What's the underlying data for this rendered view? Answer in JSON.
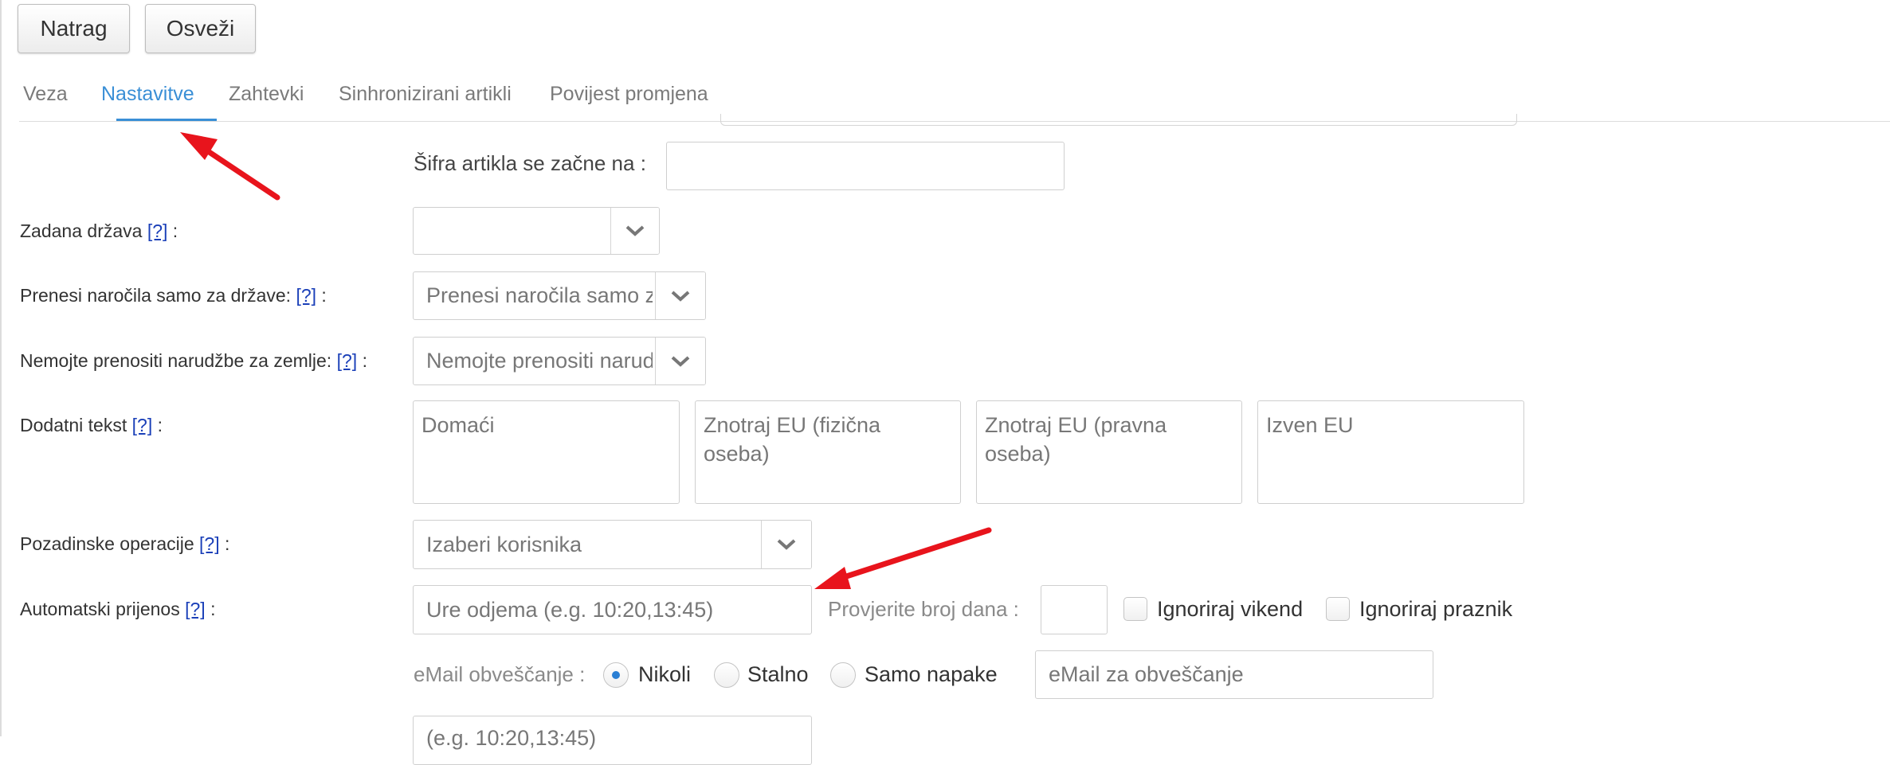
{
  "toolbar": {
    "back_label": "Natrag",
    "refresh_label": "Osveži"
  },
  "tabs": [
    {
      "label": "Veza"
    },
    {
      "label": "Nastavitve",
      "active": true
    },
    {
      "label": "Zahtevki"
    },
    {
      "label": "Sinhronizirani artikli"
    },
    {
      "label": "Povijest promjena"
    }
  ],
  "help_marker": "[?]",
  "form": {
    "sku_prefix": {
      "label": "Šifra artikla se začne na :",
      "value": ""
    },
    "default_country": {
      "label": "Zadana država",
      "suffix": ":",
      "value": ""
    },
    "transfer_only_countries": {
      "label": "Prenesi naročila samo za države:",
      "suffix": ":",
      "placeholder": "Prenesi naročila samo za države"
    },
    "exclude_countries": {
      "label": "Nemojte prenositi narudžbe za zemlje:",
      "suffix": ":",
      "placeholder": "Nemojte prenositi narudžbe za zemlje"
    },
    "additional_text": {
      "label": "Dodatni tekst",
      "suffix": ":",
      "boxes": [
        {
          "placeholder": "Domaći"
        },
        {
          "placeholder": "Znotraj EU (fizična oseba)"
        },
        {
          "placeholder": "Znotraj EU (pravna oseba)"
        },
        {
          "placeholder": "Izven EU"
        }
      ]
    },
    "background_operations": {
      "label": "Pozadinske operacije",
      "suffix": ":",
      "placeholder": "Izaberi korisnika"
    },
    "auto_transfer": {
      "label": "Automatski prijenos",
      "suffix": ":",
      "times_placeholder": "Ure odjema (e.g. 10:20,13:45)",
      "days_label": "Provjerite broj dana :",
      "days_value": "",
      "ignore_weekend_label": "Ignoriraj vikend",
      "ignore_weekend_checked": false,
      "ignore_holiday_label": "Ignoriraj praznik",
      "ignore_holiday_checked": false
    },
    "email_notification": {
      "label": "eMail obveščanje :",
      "options": [
        {
          "label": "Nikoli",
          "checked": true
        },
        {
          "label": "Stalno",
          "checked": false
        },
        {
          "label": "Samo napake",
          "checked": false
        }
      ],
      "email_placeholder": "eMail za obveščanje"
    },
    "cut_off_row": {
      "placeholder": "(e.g. 10:20,13:45)"
    }
  },
  "colors": {
    "accent": "#3a8fd6",
    "annotation_arrow": "#e8141c",
    "help_link": "#1a3fb8"
  }
}
